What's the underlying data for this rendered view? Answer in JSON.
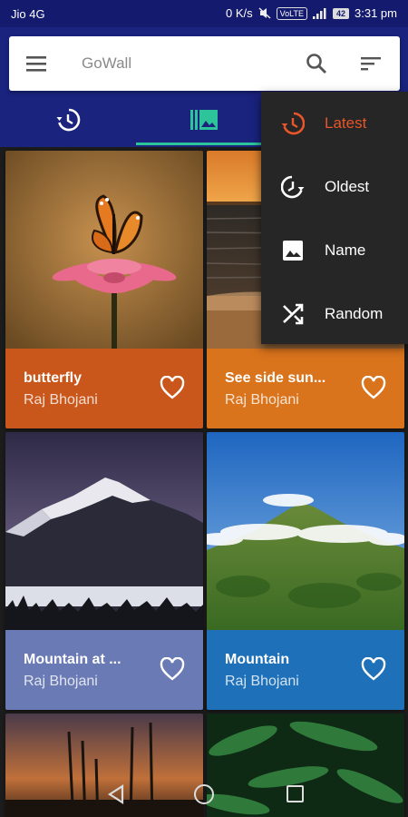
{
  "status_bar": {
    "carrier": "Jio 4G",
    "speed": "0 K/s",
    "volte": "VoLTE",
    "battery": "42",
    "time": "3:31 pm"
  },
  "app": {
    "title": "GoWall",
    "accent": "#2ec499",
    "header_color": "#1a237e"
  },
  "tabs": [
    {
      "icon": "history-icon",
      "active": false
    },
    {
      "icon": "gallery-icon",
      "active": true
    },
    {
      "icon": "category-icon",
      "active": false
    }
  ],
  "sort_menu": {
    "items": [
      {
        "label": "Latest",
        "icon": "history-icon",
        "active": true
      },
      {
        "label": "Oldest",
        "icon": "clock-rewind-icon",
        "active": false
      },
      {
        "label": "Name",
        "icon": "image-icon",
        "active": false
      },
      {
        "label": "Random",
        "icon": "shuffle-icon",
        "active": false
      }
    ],
    "active_color": "#e8562a"
  },
  "wallpapers": [
    {
      "title": "butterfly",
      "author": "Raj Bhojani",
      "caption_color": "#c9561a"
    },
    {
      "title": "See side sun...",
      "author": "Raj Bhojani",
      "caption_color": "#d9731c"
    },
    {
      "title": "Mountain at ...",
      "author": "Raj Bhojani",
      "caption_color": "#6a7ab4"
    },
    {
      "title": "Mountain",
      "author": "Raj Bhojani",
      "caption_color": "#1e70b8"
    }
  ]
}
